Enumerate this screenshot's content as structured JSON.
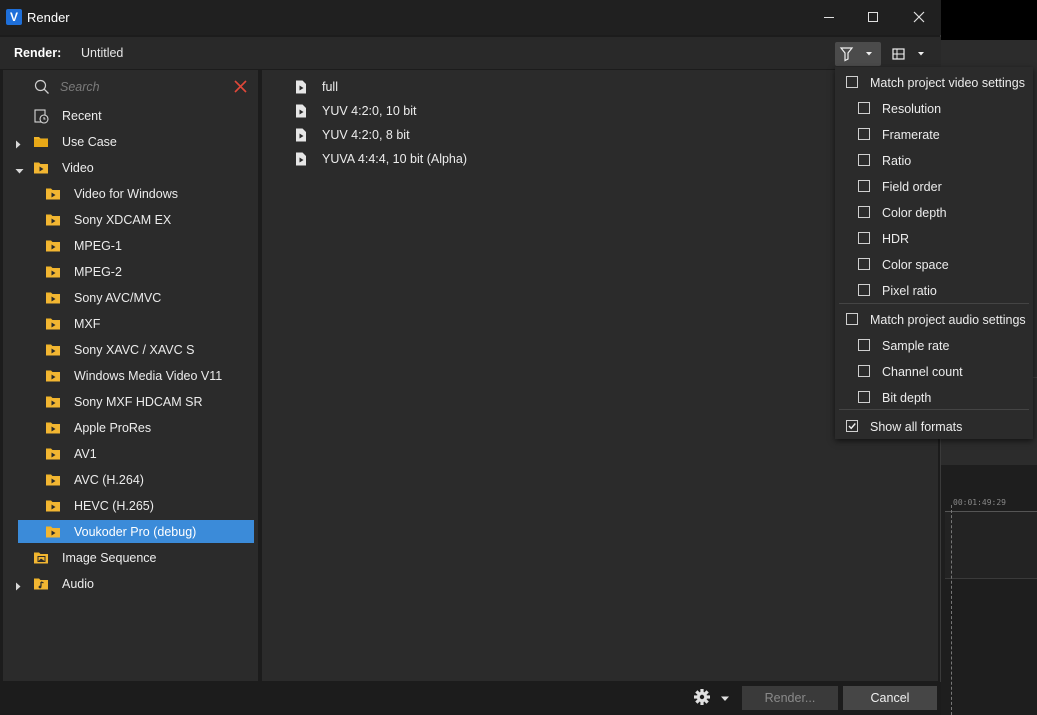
{
  "window": {
    "title": "Render",
    "app_icon": "V"
  },
  "toolbar": {
    "render_label": "Render:",
    "render_name": "Untitled"
  },
  "search": {
    "placeholder": "Search",
    "value": ""
  },
  "tree": [
    {
      "label": "Recent",
      "icon": "recent-icon"
    },
    {
      "label": "Use Case",
      "icon": "folder-icon"
    },
    {
      "label": "Video",
      "icon": "video-folder-icon"
    },
    {
      "label": "Video for Windows",
      "icon": "video-folder-icon"
    },
    {
      "label": "Sony XDCAM EX",
      "icon": "video-folder-icon"
    },
    {
      "label": "MPEG-1",
      "icon": "video-folder-icon"
    },
    {
      "label": "MPEG-2",
      "icon": "video-folder-icon"
    },
    {
      "label": "Sony AVC/MVC",
      "icon": "video-folder-icon"
    },
    {
      "label": "MXF",
      "icon": "video-folder-icon"
    },
    {
      "label": "Sony XAVC / XAVC S",
      "icon": "video-folder-icon"
    },
    {
      "label": "Windows Media Video V11",
      "icon": "video-folder-icon"
    },
    {
      "label": "Sony MXF HDCAM SR",
      "icon": "video-folder-icon"
    },
    {
      "label": "Apple ProRes",
      "icon": "video-folder-icon"
    },
    {
      "label": "AV1",
      "icon": "video-folder-icon"
    },
    {
      "label": "AVC (H.264)",
      "icon": "video-folder-icon"
    },
    {
      "label": "HEVC (H.265)",
      "icon": "video-folder-icon"
    },
    {
      "label": "Voukoder Pro (debug)",
      "icon": "video-folder-icon"
    },
    {
      "label": "Image Sequence",
      "icon": "image-folder-icon"
    },
    {
      "label": "Audio",
      "icon": "audio-folder-icon"
    }
  ],
  "selected_tree_item": "Voukoder Pro (debug)",
  "formats": [
    {
      "label": "full"
    },
    {
      "label": "YUV 4:2:0, 10 bit"
    },
    {
      "label": "YUV 4:2:0, 8 bit"
    },
    {
      "label": "YUVA 4:4:4, 10 bit (Alpha)"
    }
  ],
  "filter_menu": {
    "video_group": {
      "label": "Match project video settings",
      "checked": false
    },
    "video_items": [
      {
        "label": "Resolution",
        "checked": false
      },
      {
        "label": "Framerate",
        "checked": false
      },
      {
        "label": "Ratio",
        "checked": false
      },
      {
        "label": "Field order",
        "checked": false
      },
      {
        "label": "Color depth",
        "checked": false
      },
      {
        "label": "HDR",
        "checked": false
      },
      {
        "label": "Color space",
        "checked": false
      },
      {
        "label": "Pixel ratio",
        "checked": false
      }
    ],
    "audio_group": {
      "label": "Match project audio settings",
      "checked": false
    },
    "audio_items": [
      {
        "label": "Sample rate",
        "checked": false
      },
      {
        "label": "Channel count",
        "checked": false
      },
      {
        "label": "Bit depth",
        "checked": false
      }
    ],
    "show_all": {
      "label": "Show all formats",
      "checked": true
    }
  },
  "footer": {
    "render_button": "Render...",
    "cancel_button": "Cancel"
  },
  "background": {
    "timecode": "00:01:49:29"
  },
  "colors": {
    "accent": "#3b8bd9",
    "folder": "#f0b429",
    "close_red": "#e0483a"
  }
}
